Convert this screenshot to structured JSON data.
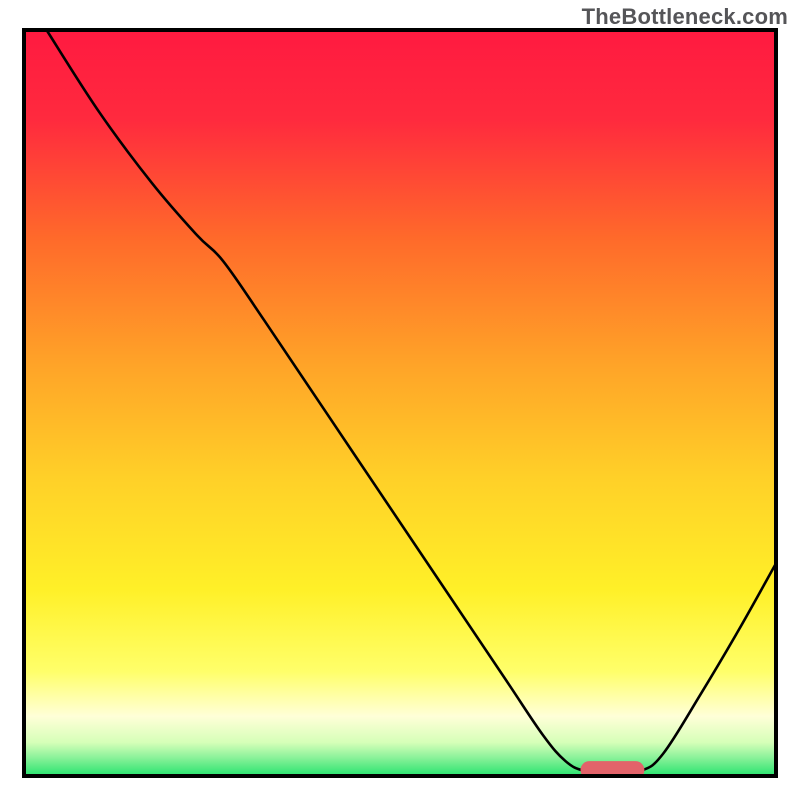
{
  "watermark": "TheBottleneck.com",
  "chart_data": {
    "type": "line",
    "title": "",
    "xlabel": "",
    "ylabel": "",
    "xlim": [
      0,
      100
    ],
    "ylim": [
      0,
      100
    ],
    "grid": false,
    "legend": false,
    "background_gradient": {
      "stops": [
        {
          "pos": 0.0,
          "color": "#ff1a40"
        },
        {
          "pos": 0.12,
          "color": "#ff2a3e"
        },
        {
          "pos": 0.28,
          "color": "#ff6a2a"
        },
        {
          "pos": 0.45,
          "color": "#ffa428"
        },
        {
          "pos": 0.6,
          "color": "#ffd028"
        },
        {
          "pos": 0.75,
          "color": "#fff028"
        },
        {
          "pos": 0.86,
          "color": "#ffff6a"
        },
        {
          "pos": 0.92,
          "color": "#ffffd8"
        },
        {
          "pos": 0.955,
          "color": "#d6ffb8"
        },
        {
          "pos": 0.975,
          "color": "#8cf29a"
        },
        {
          "pos": 1.0,
          "color": "#27e36e"
        }
      ]
    },
    "series": [
      {
        "name": "bottleneck-curve",
        "stroke": "#000000",
        "stroke_width": 2.6,
        "points": [
          {
            "x": 3.0,
            "y": 100.0
          },
          {
            "x": 10.0,
            "y": 89.0
          },
          {
            "x": 17.0,
            "y": 79.5
          },
          {
            "x": 23.0,
            "y": 72.5
          },
          {
            "x": 26.5,
            "y": 69.0
          },
          {
            "x": 32.0,
            "y": 61.0
          },
          {
            "x": 40.0,
            "y": 49.0
          },
          {
            "x": 48.0,
            "y": 37.0
          },
          {
            "x": 56.0,
            "y": 25.0
          },
          {
            "x": 64.0,
            "y": 13.0
          },
          {
            "x": 69.0,
            "y": 5.5
          },
          {
            "x": 72.0,
            "y": 2.0
          },
          {
            "x": 74.5,
            "y": 0.7
          },
          {
            "x": 78.0,
            "y": 0.4
          },
          {
            "x": 82.0,
            "y": 0.7
          },
          {
            "x": 85.0,
            "y": 3.0
          },
          {
            "x": 90.0,
            "y": 11.0
          },
          {
            "x": 95.0,
            "y": 19.5
          },
          {
            "x": 100.0,
            "y": 28.5
          }
        ]
      }
    ],
    "marker": {
      "name": "optimal-range",
      "color": "#e2636a",
      "x_start": 74.0,
      "x_end": 82.5,
      "thickness": 2.4,
      "y": 0.8
    },
    "frame": {
      "color": "#000000",
      "stroke_width": 4
    }
  }
}
